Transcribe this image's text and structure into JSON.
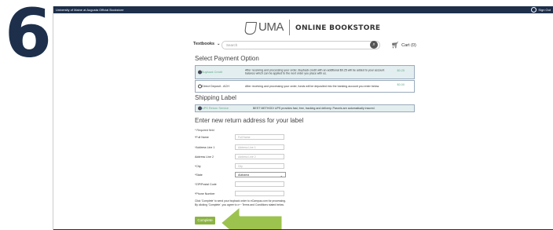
{
  "step": "6",
  "topbar": {
    "site_name": "University of Maine at Augusta Official Bookstore",
    "signout_label": "Sign Out"
  },
  "logo": {
    "uma": "UMA",
    "store": "ONLINE BOOKSTORE"
  },
  "search": {
    "textbooks_label": "Textbooks",
    "placeholder": "Search",
    "cart_label": "Cart (0)"
  },
  "payment": {
    "title": "Select Payment Option",
    "options": [
      {
        "name": "Buyback Credit",
        "desc": "After receiving and processing your order, Buyback credit with an additional $0.25 will be added to your account balance which can be applied to the next order you place with us.",
        "price": "$0.25"
      },
      {
        "name": "Direct Deposit - ACH",
        "desc": "After receiving and processing your order, funds will be deposited into the banking account you enter below.",
        "price": "$0.00"
      }
    ]
  },
  "shipping": {
    "title": "Shipping Label",
    "option": {
      "name": "UPS Return Service",
      "desc": "BEST METHOD! UPS provides fast, free, tracking and delivery. Parcels are automatically insured."
    }
  },
  "address": {
    "title": "Enter new return address for your label",
    "required_note": "* Required field",
    "fields": [
      {
        "label": "*Full Name",
        "placeholder": "Full Name"
      },
      {
        "label": "*Address Line 1",
        "placeholder": "Address Line 1"
      },
      {
        "label": "Address Line 2",
        "placeholder": "Address Line 2"
      },
      {
        "label": "*City",
        "placeholder": "City"
      },
      {
        "label": "*State",
        "value": "Alabama"
      },
      {
        "label": "*ZIP/Postal Code",
        "placeholder": ""
      },
      {
        "label": "*Phone Number",
        "placeholder": ""
      }
    ]
  },
  "consent": "Click 'Complete' to send your buyback order to eCampus.com for processing. By clicking 'Complete', you agree to our Terms and Conditions stated below.",
  "complete_label": "Complete",
  "colors": {
    "navy": "#1d2f4b",
    "green": "#8cb443",
    "selected_bg": "#e3eef0"
  }
}
